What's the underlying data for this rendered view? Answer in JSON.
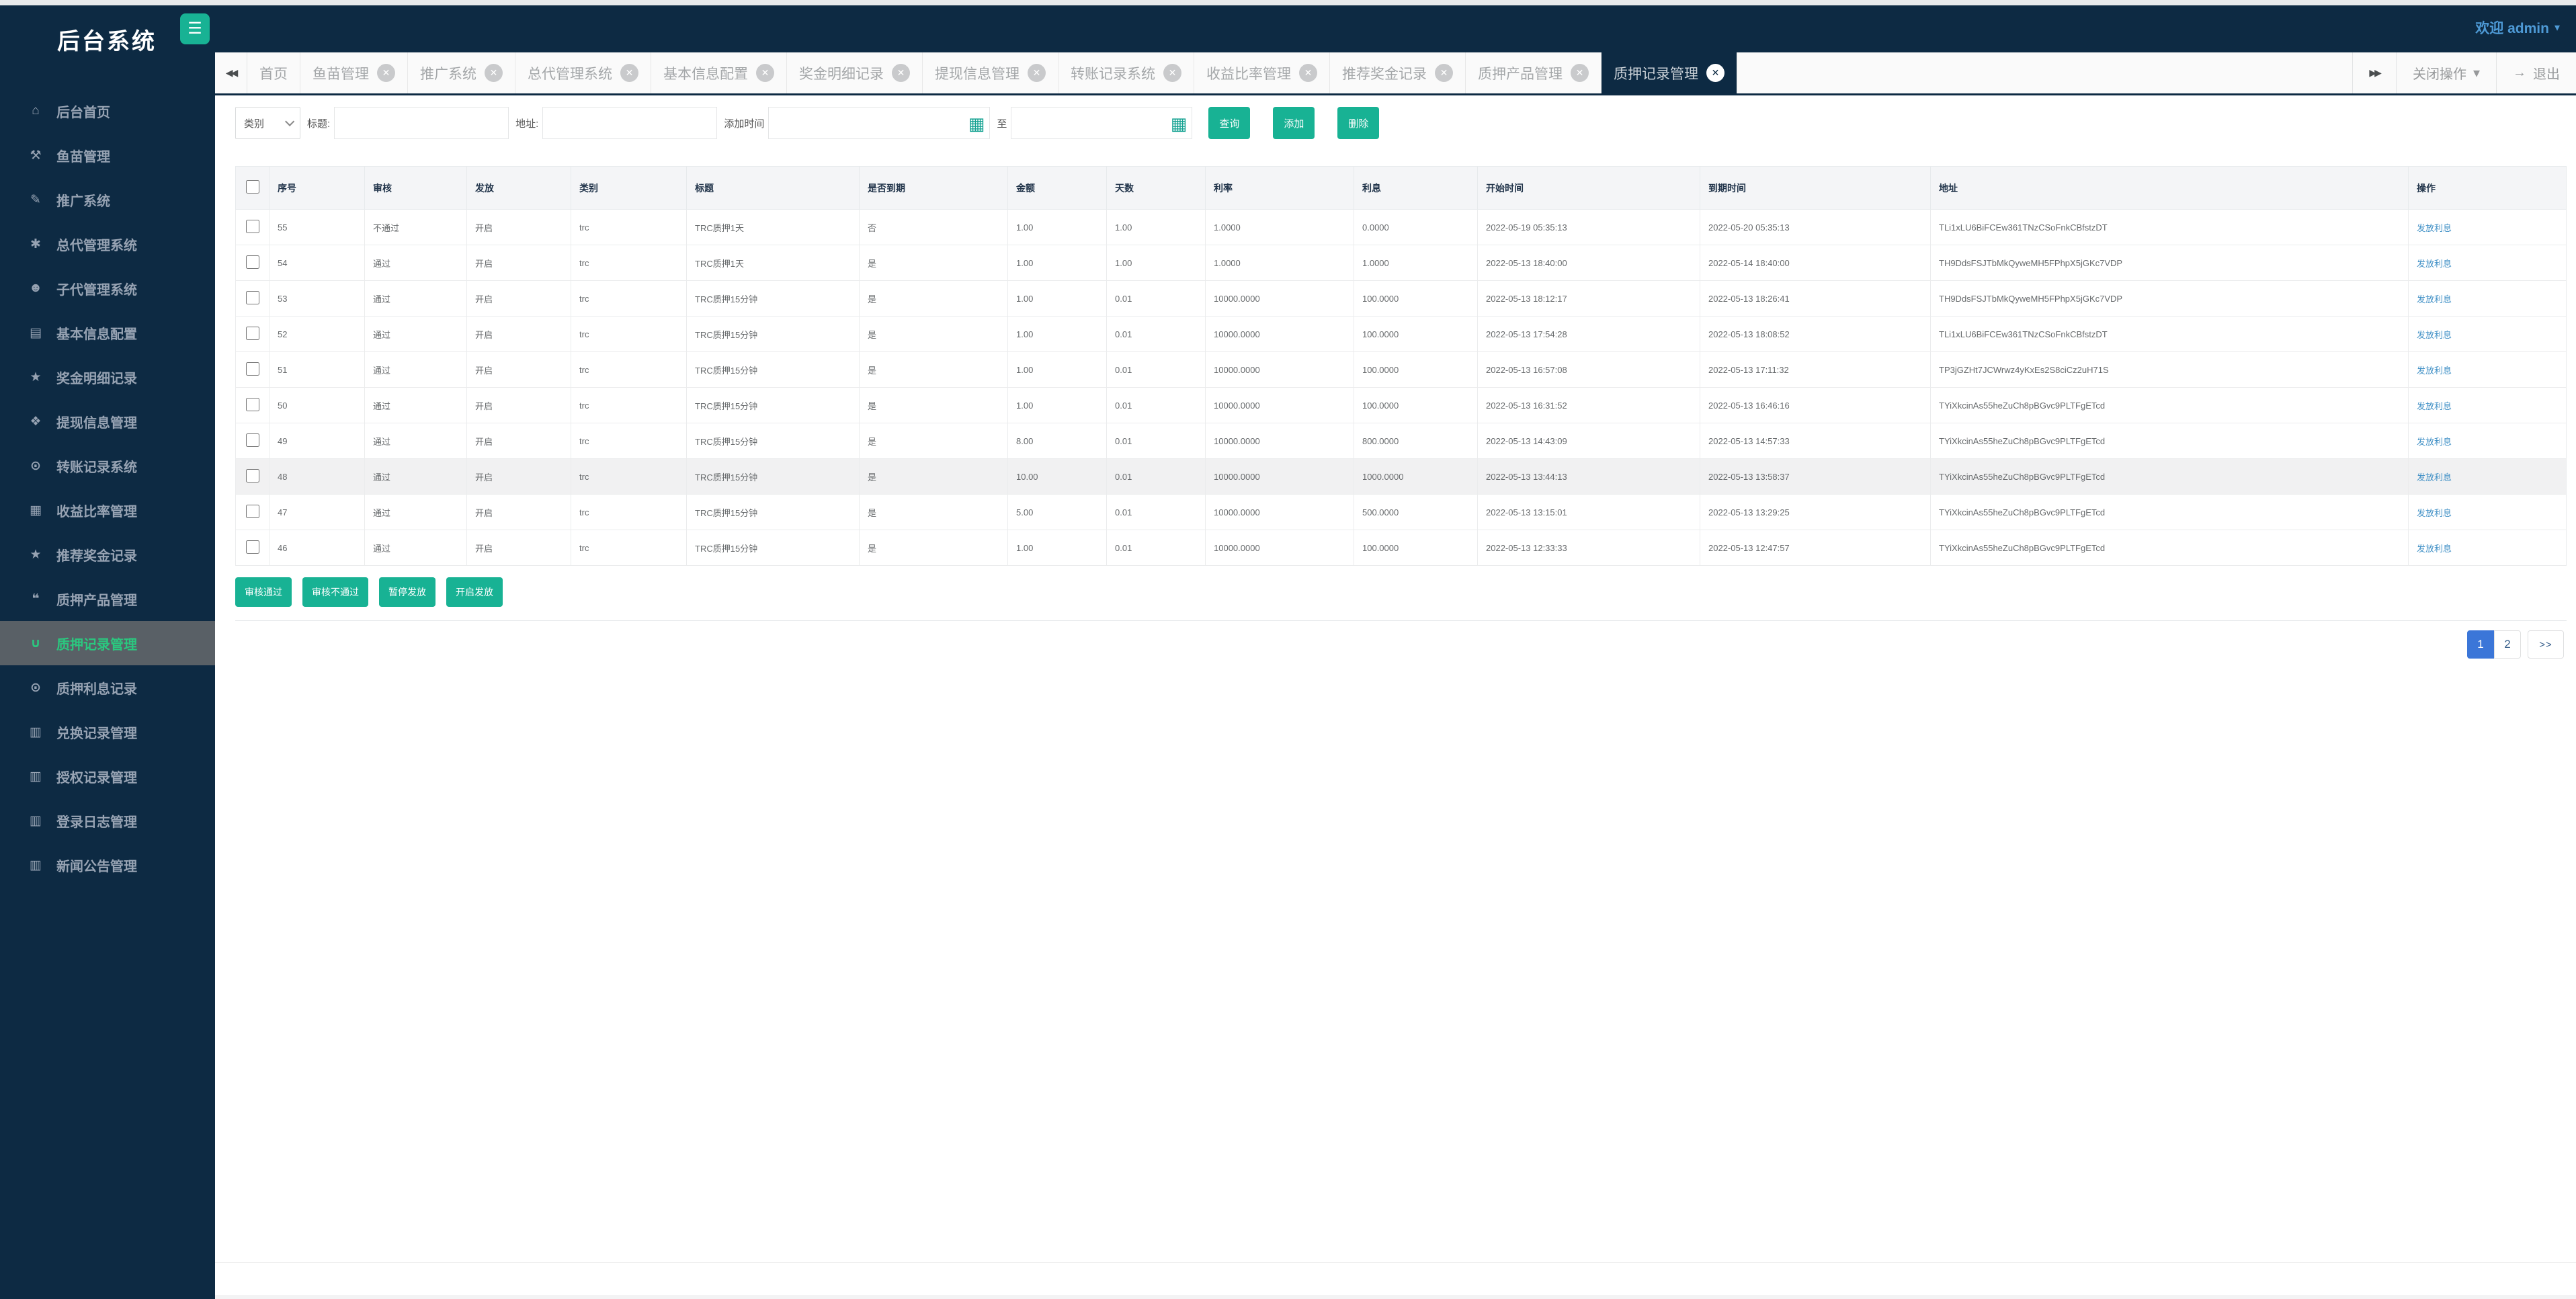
{
  "brand": {
    "title": "后台系统"
  },
  "topbar": {
    "welcome": "欢迎 admin"
  },
  "icons": {
    "hamburger": "☰",
    "caret_down": "▾",
    "tabs_scroll_left": "◀◀",
    "tabs_scroll_right": "▶▶",
    "tab_close": "✕",
    "logout_arrow": "→",
    "calendar": "▦"
  },
  "sidebar": {
    "items": [
      {
        "label": "后台首页",
        "icon": "home",
        "glyph": "⌂",
        "active": false
      },
      {
        "label": "鱼苗管理",
        "icon": "wrench",
        "glyph": "⚒",
        "active": false
      },
      {
        "label": "推广系统",
        "icon": "edit",
        "glyph": "✎",
        "active": false
      },
      {
        "label": "总代管理系统",
        "icon": "asterisk",
        "glyph": "✱",
        "active": false
      },
      {
        "label": "子代管理系统",
        "icon": "users",
        "glyph": "☻",
        "active": false
      },
      {
        "label": "基本信息配置",
        "icon": "file",
        "glyph": "▤",
        "active": false
      },
      {
        "label": "奖金明细记录",
        "icon": "star",
        "glyph": "★",
        "active": false
      },
      {
        "label": "提现信息管理",
        "icon": "tag",
        "glyph": "❖",
        "active": false
      },
      {
        "label": "转账记录系统",
        "icon": "power",
        "glyph": "⊙",
        "active": false
      },
      {
        "label": "收益比率管理",
        "icon": "calendar",
        "glyph": "▦",
        "active": false
      },
      {
        "label": "推荐奖金记录",
        "icon": "star",
        "glyph": "★",
        "active": false
      },
      {
        "label": "质押产品管理",
        "icon": "comment",
        "glyph": "❝",
        "active": false
      },
      {
        "label": "质押记录管理",
        "icon": "magnet",
        "glyph": "∪",
        "active": true
      },
      {
        "label": "质押利息记录",
        "icon": "power",
        "glyph": "⊙",
        "active": false
      },
      {
        "label": "兑换记录管理",
        "icon": "book",
        "glyph": "▥",
        "active": false
      },
      {
        "label": "授权记录管理",
        "icon": "book",
        "glyph": "▥",
        "active": false
      },
      {
        "label": "登录日志管理",
        "icon": "book",
        "glyph": "▥",
        "active": false
      },
      {
        "label": "新闻公告管理",
        "icon": "book",
        "glyph": "▥",
        "active": false
      }
    ]
  },
  "tabs": {
    "items": [
      {
        "label": "首页",
        "closable": false,
        "active": false
      },
      {
        "label": "鱼苗管理",
        "closable": true,
        "active": false
      },
      {
        "label": "推广系统",
        "closable": true,
        "active": false
      },
      {
        "label": "总代管理系统",
        "closable": true,
        "active": false
      },
      {
        "label": "基本信息配置",
        "closable": true,
        "active": false
      },
      {
        "label": "奖金明细记录",
        "closable": true,
        "active": false
      },
      {
        "label": "提现信息管理",
        "closable": true,
        "active": false
      },
      {
        "label": "转账记录系统",
        "closable": true,
        "active": false
      },
      {
        "label": "收益比率管理",
        "closable": true,
        "active": false
      },
      {
        "label": "推荐奖金记录",
        "closable": true,
        "active": false
      },
      {
        "label": "质押产品管理",
        "closable": true,
        "active": false
      },
      {
        "label": "质押记录管理",
        "closable": true,
        "active": true
      }
    ],
    "close_operations": "关闭操作",
    "logout": "退出"
  },
  "filters": {
    "category": {
      "label": "类别",
      "value": ""
    },
    "title": {
      "label": "标题:",
      "value": ""
    },
    "address": {
      "label": "地址:",
      "value": ""
    },
    "add_time": {
      "label": "添加时间",
      "from_value": "",
      "to_label": "至",
      "to_value": ""
    },
    "search_button": "查询",
    "add_button": "添加",
    "delete_button": "删除"
  },
  "table": {
    "headers": [
      "序号",
      "审核",
      "发放",
      "类别",
      "标题",
      "是否到期",
      "金额",
      "天数",
      "利率",
      "利息",
      "开始时间",
      "到期时间",
      "地址",
      "操作"
    ],
    "highlighted_row_index": 7,
    "rows": [
      {
        "cells": [
          "55",
          "不通过",
          "开启",
          "trc",
          "TRC质押1天",
          "否",
          "1.00",
          "1.00",
          "1.0000",
          "0.0000",
          "2022-05-19 05:35:13",
          "2022-05-20 05:35:13",
          "TLi1xLU6BiFCEw361TNzCSoFnkCBfstzDT"
        ],
        "action": "发放利息"
      },
      {
        "cells": [
          "54",
          "通过",
          "开启",
          "trc",
          "TRC质押1天",
          "是",
          "1.00",
          "1.00",
          "1.0000",
          "1.0000",
          "2022-05-13 18:40:00",
          "2022-05-14 18:40:00",
          "TH9DdsFSJTbMkQyweMH5FPhpX5jGKc7VDP"
        ],
        "action": "发放利息"
      },
      {
        "cells": [
          "53",
          "通过",
          "开启",
          "trc",
          "TRC质押15分钟",
          "是",
          "1.00",
          "0.01",
          "10000.0000",
          "100.0000",
          "2022-05-13 18:12:17",
          "2022-05-13 18:26:41",
          "TH9DdsFSJTbMkQyweMH5FPhpX5jGKc7VDP"
        ],
        "action": "发放利息"
      },
      {
        "cells": [
          "52",
          "通过",
          "开启",
          "trc",
          "TRC质押15分钟",
          "是",
          "1.00",
          "0.01",
          "10000.0000",
          "100.0000",
          "2022-05-13 17:54:28",
          "2022-05-13 18:08:52",
          "TLi1xLU6BiFCEw361TNzCSoFnkCBfstzDT"
        ],
        "action": "发放利息"
      },
      {
        "cells": [
          "51",
          "通过",
          "开启",
          "trc",
          "TRC质押15分钟",
          "是",
          "1.00",
          "0.01",
          "10000.0000",
          "100.0000",
          "2022-05-13 16:57:08",
          "2022-05-13 17:11:32",
          "TP3jGZHt7JCWrwz4yKxEs2S8ciCz2uH71S"
        ],
        "action": "发放利息"
      },
      {
        "cells": [
          "50",
          "通过",
          "开启",
          "trc",
          "TRC质押15分钟",
          "是",
          "1.00",
          "0.01",
          "10000.0000",
          "100.0000",
          "2022-05-13 16:31:52",
          "2022-05-13 16:46:16",
          "TYiXkcinAs55heZuCh8pBGvc9PLTFgETcd"
        ],
        "action": "发放利息"
      },
      {
        "cells": [
          "49",
          "通过",
          "开启",
          "trc",
          "TRC质押15分钟",
          "是",
          "8.00",
          "0.01",
          "10000.0000",
          "800.0000",
          "2022-05-13 14:43:09",
          "2022-05-13 14:57:33",
          "TYiXkcinAs55heZuCh8pBGvc9PLTFgETcd"
        ],
        "action": "发放利息"
      },
      {
        "cells": [
          "48",
          "通过",
          "开启",
          "trc",
          "TRC质押15分钟",
          "是",
          "10.00",
          "0.01",
          "10000.0000",
          "1000.0000",
          "2022-05-13 13:44:13",
          "2022-05-13 13:58:37",
          "TYiXkcinAs55heZuCh8pBGvc9PLTFgETcd"
        ],
        "action": "发放利息"
      },
      {
        "cells": [
          "47",
          "通过",
          "开启",
          "trc",
          "TRC质押15分钟",
          "是",
          "5.00",
          "0.01",
          "10000.0000",
          "500.0000",
          "2022-05-13 13:15:01",
          "2022-05-13 13:29:25",
          "TYiXkcinAs55heZuCh8pBGvc9PLTFgETcd"
        ],
        "action": "发放利息"
      },
      {
        "cells": [
          "46",
          "通过",
          "开启",
          "trc",
          "TRC质押15分钟",
          "是",
          "1.00",
          "0.01",
          "10000.0000",
          "100.0000",
          "2022-05-13 12:33:33",
          "2022-05-13 12:47:57",
          "TYiXkcinAs55heZuCh8pBGvc9PLTFgETcd"
        ],
        "action": "发放利息"
      }
    ]
  },
  "bulk_actions": [
    "审核通过",
    "审核不通过",
    "暂停发放",
    "开启发放"
  ],
  "pagination": {
    "pages": [
      {
        "label": "1",
        "active": true
      },
      {
        "label": "2",
        "active": false
      }
    ],
    "next": ">>"
  }
}
